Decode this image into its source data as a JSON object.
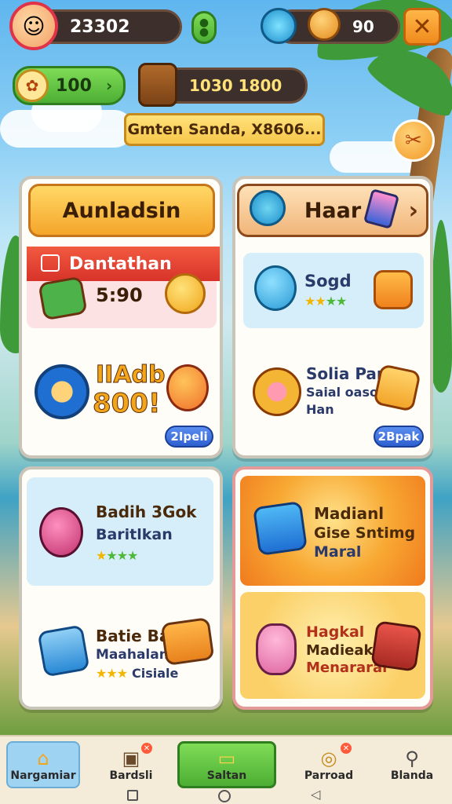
{
  "top_bar": {
    "player_score": "23302",
    "gems_value": "90",
    "currency_green": "100",
    "chest_value": "1030 1800",
    "banner_text": "Gmten Sanda, X8606..."
  },
  "panels": {
    "top_left": {
      "title": "Aunladsin",
      "red_banner": "Dantathan",
      "timer": "5:90",
      "promo_text_line1": "IIAdb",
      "promo_text_line2": "800!",
      "button": "2Ipeli"
    },
    "top_right": {
      "title": "Haar",
      "item1_name": "Sogd",
      "item1_stars": 4,
      "item2_name": "Solia Pan",
      "item2_line2": "Saial oaso",
      "item2_line3": "Han",
      "button": "2Bpak"
    },
    "bottom_left": {
      "item1_name": "Badih 3Gok",
      "item1_line2": "Baritlkan",
      "item1_stars": 4,
      "item2_name": "Batie Bae",
      "item2_line2": "Maahalan",
      "item2_line3": "Cisiale"
    },
    "bottom_right": {
      "item1_line1": "Madianl",
      "item1_line2": "Gise Sntimg",
      "item1_line3": "Maral",
      "item2_line1": "Hagkal",
      "item2_line2": "Madieak",
      "item2_line3": "Menararal"
    }
  },
  "bottom_nav": {
    "items": [
      {
        "label": "Nargamiar",
        "icon": "home-icon",
        "active": true
      },
      {
        "label": "Bardsli",
        "icon": "box-icon",
        "badge": true
      },
      {
        "label": "Saltan",
        "icon": "ticket-icon",
        "highlight": true
      },
      {
        "label": "Parroad",
        "icon": "coins-icon",
        "badge": true
      },
      {
        "label": "Blanda",
        "icon": "pin-icon"
      }
    ]
  },
  "colors": {
    "accent_orange": "#f7b731",
    "accent_green": "#4cae33",
    "accent_blue": "#2d5fd0",
    "red_banner": "#e64030"
  }
}
